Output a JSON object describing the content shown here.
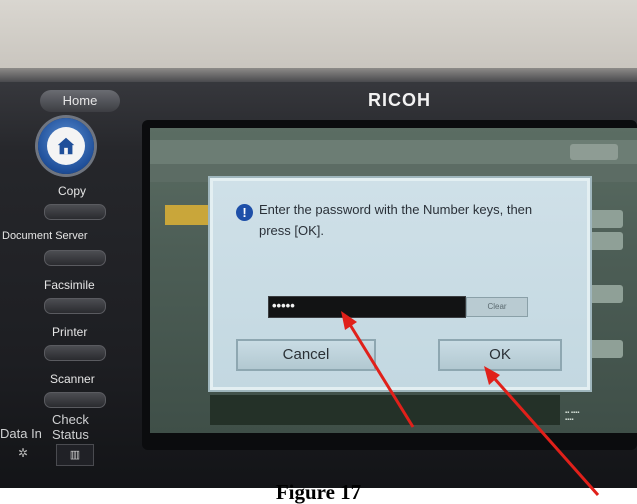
{
  "panel": {
    "brand": "RICOH",
    "home_label": "Home",
    "side_buttons": [
      "Copy",
      "Document Server",
      "Facsimile",
      "Printer",
      "Scanner"
    ],
    "check_status_label": "Check\nStatus",
    "data_in_label": "Data In",
    "status_key_glyph": "▥"
  },
  "dialog": {
    "message": "Enter the password with the Number keys, then press [OK].",
    "password_mask": "•••••",
    "clear_label": "Clear",
    "cancel_label": "Cancel",
    "ok_label": "OK"
  },
  "annotations": {
    "arrow_color": "#e0201a"
  },
  "caption": "Figure 17"
}
